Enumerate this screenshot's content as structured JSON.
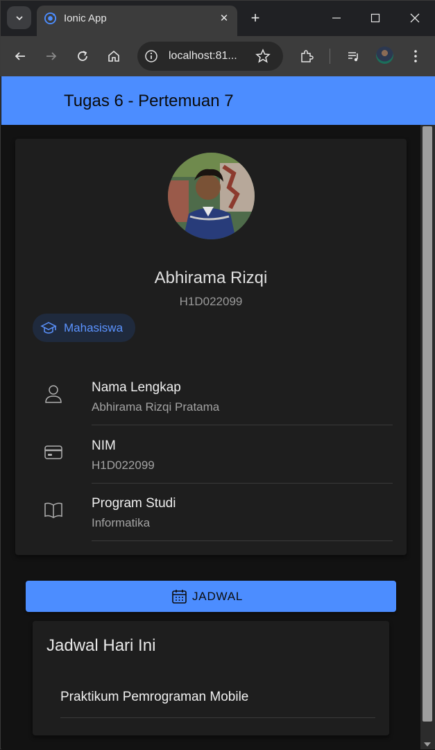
{
  "browser": {
    "tab_title": "Ionic App",
    "url": "localhost:81...",
    "new_tab_symbol": "+",
    "close_symbol": "✕"
  },
  "app": {
    "header_title": "Tugas 6 - Pertemuan 7"
  },
  "profile": {
    "name": "Abhirama Rizqi",
    "nim": "H1D022099",
    "role_chip": "Mahasiswa",
    "details": [
      {
        "icon": "person-icon",
        "label": "Nama Lengkap",
        "value": "Abhirama Rizqi Pratama"
      },
      {
        "icon": "card-icon",
        "label": "NIM",
        "value": "H1D022099"
      },
      {
        "icon": "book-icon",
        "label": "Program Studi",
        "value": "Informatika"
      }
    ]
  },
  "schedule": {
    "button_label": "JADWAL",
    "card_title": "Jadwal Hari Ini",
    "items": [
      "Praktikum Pemrograman Mobile"
    ]
  },
  "colors": {
    "primary": "#4c8dff",
    "background": "#121212",
    "card": "#1e1e1e"
  }
}
